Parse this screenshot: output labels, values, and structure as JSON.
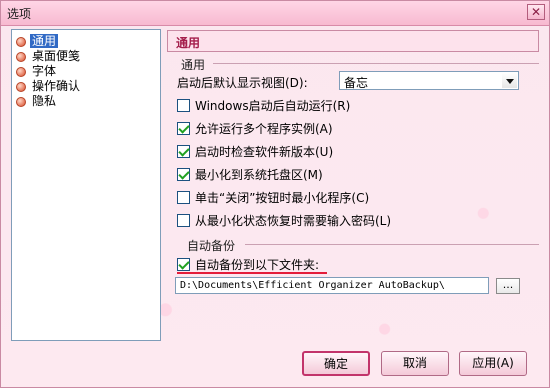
{
  "window": {
    "title": "选项",
    "close_glyph": "✕"
  },
  "nav": {
    "items": [
      {
        "label": "通用",
        "selected": true
      },
      {
        "label": "桌面便笺"
      },
      {
        "label": "字体"
      },
      {
        "label": "操作确认"
      },
      {
        "label": "隐私"
      }
    ]
  },
  "panel": {
    "header": "通用"
  },
  "general": {
    "group_label": "通用",
    "startup_view_label": "启动后默认显示视图(D):",
    "startup_view_value": "备忘",
    "options": [
      {
        "label": "Windows启动后自动运行(R)",
        "checked": false
      },
      {
        "label": "允许运行多个程序实例(A)",
        "checked": true
      },
      {
        "label": "启动时检查软件新版本(U)",
        "checked": true
      },
      {
        "label": "最小化到系统托盘区(M)",
        "checked": true
      },
      {
        "label": "单击“关闭”按钮时最小化程序(C)",
        "checked": false
      },
      {
        "label": "从最小化状态恢复时需要输入密码(L)",
        "checked": false
      }
    ]
  },
  "backup": {
    "group_label": "自动备份",
    "checkbox_label": "自动备份到以下文件夹:",
    "checked": true,
    "path_value": "D:\\Documents\\Efficient Organizer AutoBackup\\",
    "browse_label": "..."
  },
  "buttons": {
    "ok": "确定",
    "cancel": "取消",
    "apply": "应用(A)"
  },
  "colors": {
    "accent": "#a41e4b",
    "highlight": "#e41c3a",
    "selection": "#316ac5"
  }
}
